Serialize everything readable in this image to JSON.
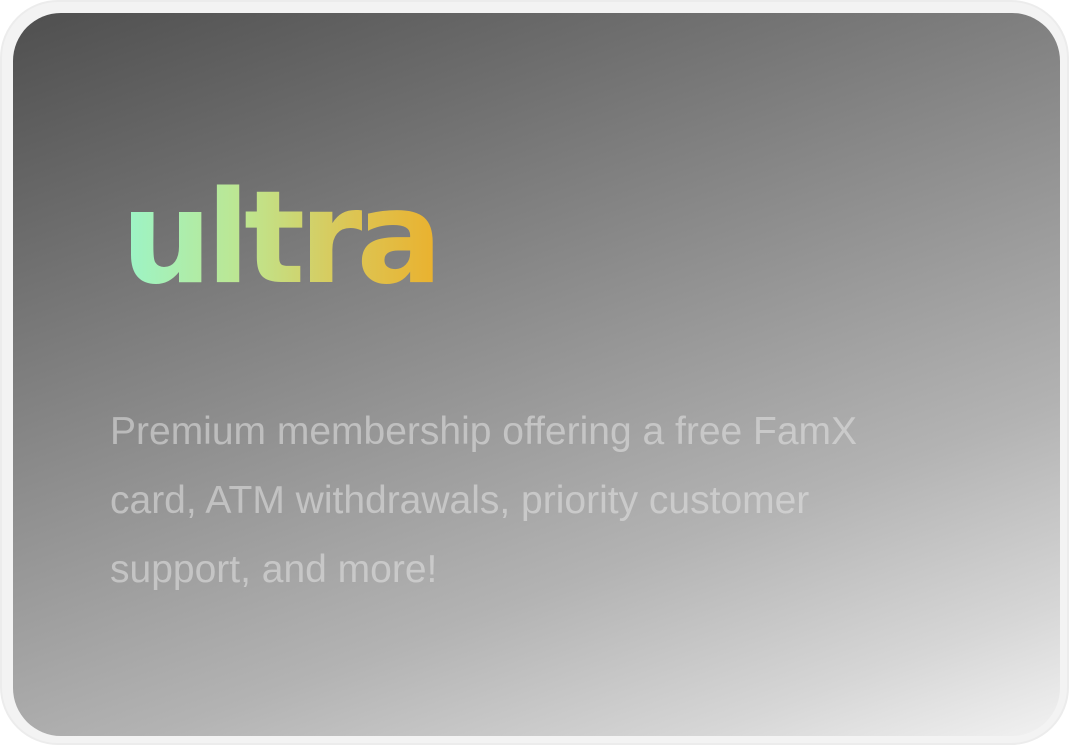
{
  "card": {
    "brand": "ultra",
    "description": "Premium membership offering a free FamX card, ATM withdrawals, priority customer support, and more!"
  },
  "colors": {
    "logo_gradient_start": "#9bf5c9",
    "logo_gradient_end": "#eab12e",
    "card_gradient_dark": "#4f4f4f",
    "card_gradient_light": "#f2f2f2"
  }
}
